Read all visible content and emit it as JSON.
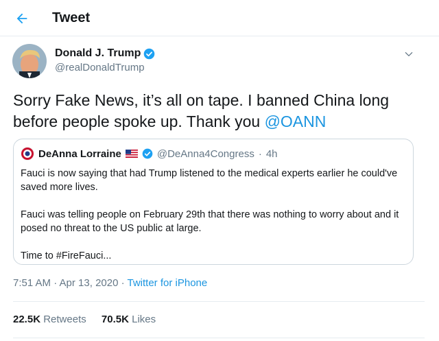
{
  "header": {
    "title": "Tweet",
    "back_icon": "arrow-left-icon"
  },
  "tweet": {
    "author": {
      "display_name": "Donald J. Trump",
      "handle": "@realDonaldTrump",
      "verified": true
    },
    "text_main": "Sorry Fake News, it’s all on tape. I banned China long before people spoke up. Thank you ",
    "mention": "@OANN",
    "timestamp": "7:51 AM · Apr 13, 2020 · ",
    "source": "Twitter for iPhone",
    "stats": {
      "retweets_count": "22.5K",
      "retweets_label": "Retweets",
      "likes_count": "70.5K",
      "likes_label": "Likes"
    }
  },
  "quoted_tweet": {
    "display_name": "DeAnna Lorraine",
    "flag_icon": "us-flag-icon",
    "verified": true,
    "handle": "@DeAnna4Congress",
    "separator": "·",
    "time": "4h",
    "paragraphs": [
      "Fauci is now saying that had Trump listened to the medical experts earlier he could've saved more lives.",
      "Fauci was telling people on February 29th that there was nothing to worry about and it posed no threat to the US public at large.",
      "Time to #FireFauci..."
    ]
  },
  "colors": {
    "accent": "#1b95e0",
    "verified": "#1da1f2",
    "muted_text": "#657786",
    "border": "#ccd6dd"
  }
}
